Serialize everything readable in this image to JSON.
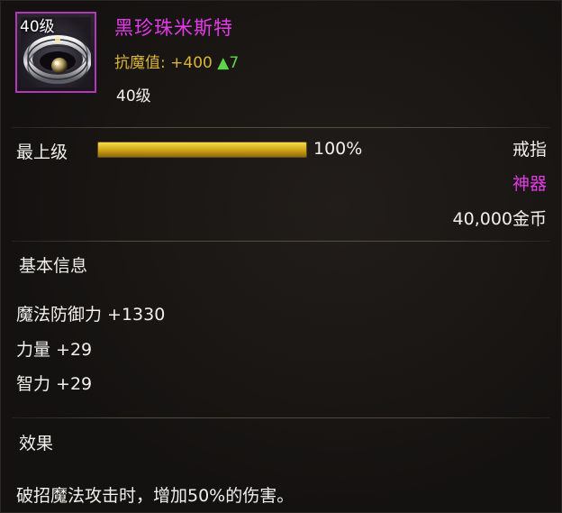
{
  "item": {
    "icon_level": "40级",
    "icon": "silver-ring-with-pearl-icon",
    "name": "黑珍珠米斯特",
    "stat_line": {
      "label": "抗魔值:",
      "value": "+400",
      "delta": "▲7"
    },
    "level": "40级"
  },
  "upgrade": {
    "label": "最上级",
    "progress_fraction": 1.0,
    "progress_text": "100%"
  },
  "meta": {
    "type": "戒指",
    "rarity": "神器",
    "price": "40,000金币"
  },
  "basic_info": {
    "title": "基本信息",
    "attributes": [
      "魔法防御力 +1330",
      "力量 +29",
      "智力 +29"
    ]
  },
  "effect": {
    "title": "效果",
    "description": "破招魔法攻击时，增加50%的伤害。"
  },
  "colors": {
    "name": "#e43ae8",
    "rarity": "#e43ae8",
    "stat": "#d8b53a",
    "delta": "#5ed64b",
    "progress": "#e8c42a",
    "frame": "#b338b7"
  }
}
